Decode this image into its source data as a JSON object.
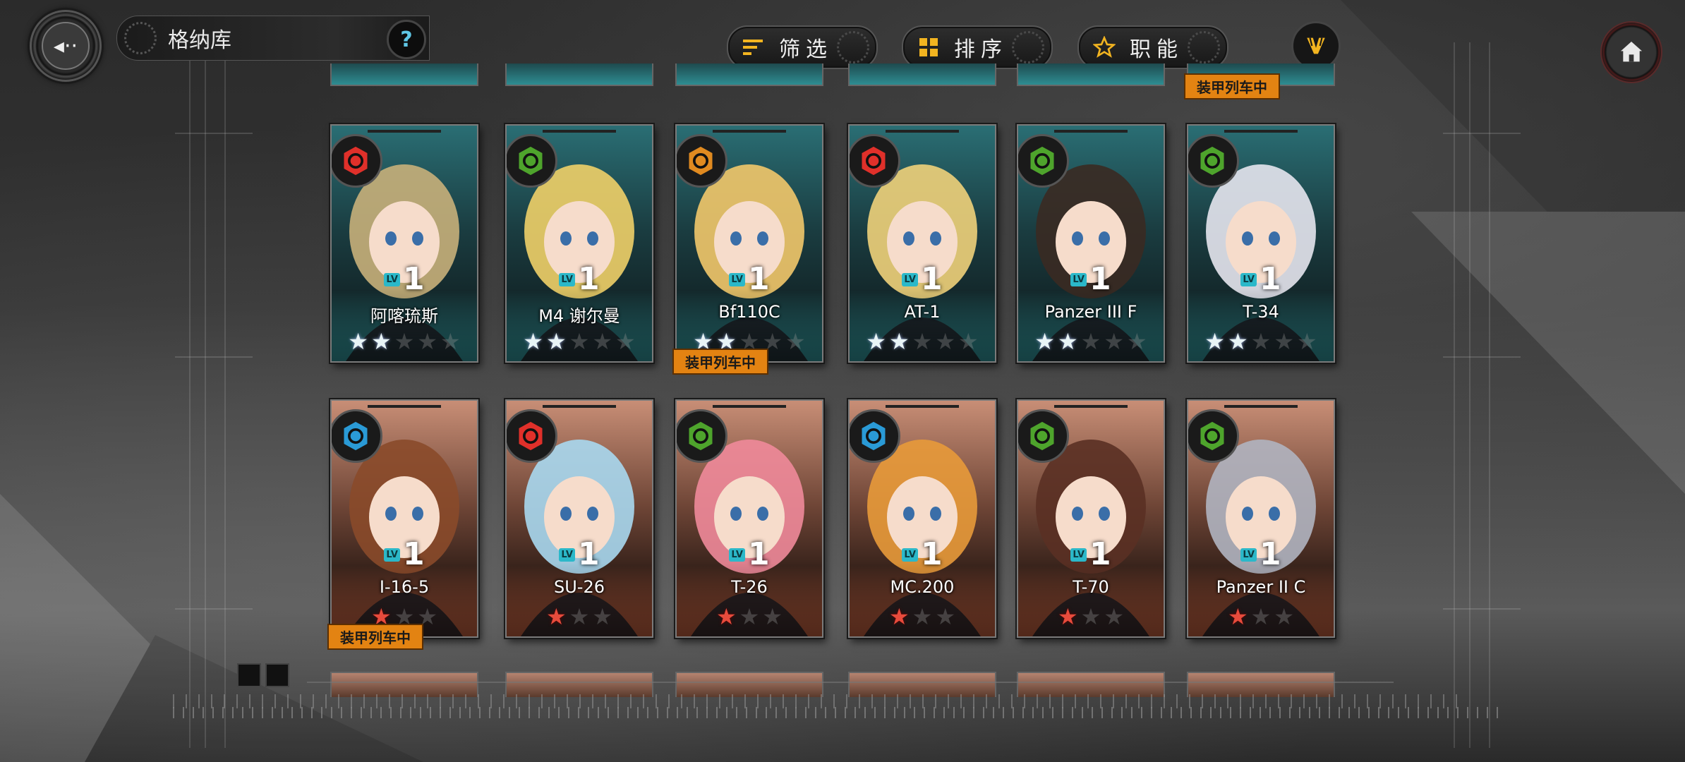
{
  "header": {
    "title": "格纳库",
    "help_label": "?",
    "filter_label": "筛选",
    "sort_label": "排序",
    "role_label": "职能"
  },
  "badge_text": "装甲列车中",
  "colors": {
    "train_badge": "#e38312",
    "level_badge": "#2bb8c9",
    "icon_red": "#e0302a",
    "icon_green": "#4ea42c",
    "icon_orange": "#e08a20",
    "icon_blue": "#2a9ad6"
  },
  "rows": [
    {
      "cards": [
        {
          "name": "阿喀琉斯",
          "level": "1",
          "lv_tag": "LV",
          "rarity": 2,
          "max_stars": 5,
          "frame": "teal",
          "class_icon": "gear-red-icon",
          "icon_color": "#e0302a",
          "in_train": false
        },
        {
          "name": "M4 谢尔曼",
          "level": "1",
          "lv_tag": "LV",
          "rarity": 2,
          "max_stars": 5,
          "frame": "teal",
          "class_icon": "leaf-green-icon",
          "icon_color": "#4ea42c",
          "in_train": false
        },
        {
          "name": "Bf110C",
          "level": "1",
          "lv_tag": "LV",
          "rarity": 2,
          "max_stars": 5,
          "frame": "teal",
          "class_icon": "flame-orange-icon",
          "icon_color": "#e08a20",
          "in_train": true
        },
        {
          "name": "AT-1",
          "level": "1",
          "lv_tag": "LV",
          "rarity": 2,
          "max_stars": 5,
          "frame": "teal",
          "class_icon": "gear-red-icon",
          "icon_color": "#e0302a",
          "in_train": false
        },
        {
          "name": "Panzer III F",
          "level": "1",
          "lv_tag": "LV",
          "rarity": 2,
          "max_stars": 5,
          "frame": "teal",
          "class_icon": "leaf-green-icon",
          "icon_color": "#4ea42c",
          "in_train": false
        },
        {
          "name": "T-34",
          "level": "1",
          "lv_tag": "LV",
          "rarity": 2,
          "max_stars": 5,
          "frame": "teal",
          "class_icon": "leaf-green-icon",
          "icon_color": "#4ea42c",
          "in_train": false
        }
      ]
    },
    {
      "cards": [
        {
          "name": "I-16-5",
          "level": "1",
          "lv_tag": "LV",
          "rarity": 1,
          "max_stars": 3,
          "frame": "bronze",
          "class_icon": "snowflake-blue-icon",
          "icon_color": "#2a9ad6",
          "in_train": true
        },
        {
          "name": "SU-26",
          "level": "1",
          "lv_tag": "LV",
          "rarity": 1,
          "max_stars": 3,
          "frame": "bronze",
          "class_icon": "gear-red-icon",
          "icon_color": "#e0302a",
          "in_train": false
        },
        {
          "name": "T-26",
          "level": "1",
          "lv_tag": "LV",
          "rarity": 1,
          "max_stars": 3,
          "frame": "bronze",
          "class_icon": "leaf-green-icon",
          "icon_color": "#4ea42c",
          "in_train": false
        },
        {
          "name": "MC.200",
          "level": "1",
          "lv_tag": "LV",
          "rarity": 1,
          "max_stars": 3,
          "frame": "bronze",
          "class_icon": "shield-blue-icon",
          "icon_color": "#2a9ad6",
          "in_train": false
        },
        {
          "name": "T-70",
          "level": "1",
          "lv_tag": "LV",
          "rarity": 1,
          "max_stars": 3,
          "frame": "bronze",
          "class_icon": "leaf-green-icon",
          "icon_color": "#4ea42c",
          "in_train": false
        },
        {
          "name": "Panzer II C",
          "level": "1",
          "lv_tag": "LV",
          "rarity": 1,
          "max_stars": 3,
          "frame": "bronze",
          "class_icon": "leaf-green-icon",
          "icon_color": "#4ea42c",
          "in_train": false
        }
      ]
    }
  ],
  "partial_top_badge_index": 5
}
